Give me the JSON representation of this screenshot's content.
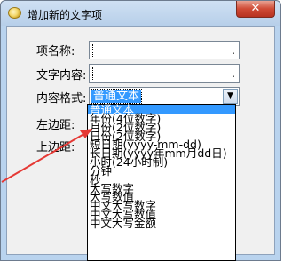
{
  "window": {
    "title": "增加新的文字项",
    "close_label": "✕"
  },
  "form": {
    "name_label": "项名称:",
    "content_label": "文字内容:",
    "format_label": "内容格式:",
    "left_margin_label": "左边距:",
    "top_margin_label": "上边距:",
    "name_value": "",
    "content_value": "",
    "field_indicator": ".",
    "format_selected": "普通文本"
  },
  "dropdown": {
    "options": [
      "普通文本",
      "年份(4位数字)",
      "月份(2位数字)",
      "日份(2位数字)",
      "短日期(yyyy-mm-dd)",
      "长日期(yyyy年mm月dd日)",
      "小时(24小时制)",
      "分钟",
      "秒",
      "大写数字",
      "大写数值",
      "中文大写数字",
      "中文大写数值",
      "中文大写金额"
    ],
    "selected_index": 0
  },
  "colors": {
    "highlight": "#3399ff",
    "annotation_arrow": "#e53935"
  }
}
